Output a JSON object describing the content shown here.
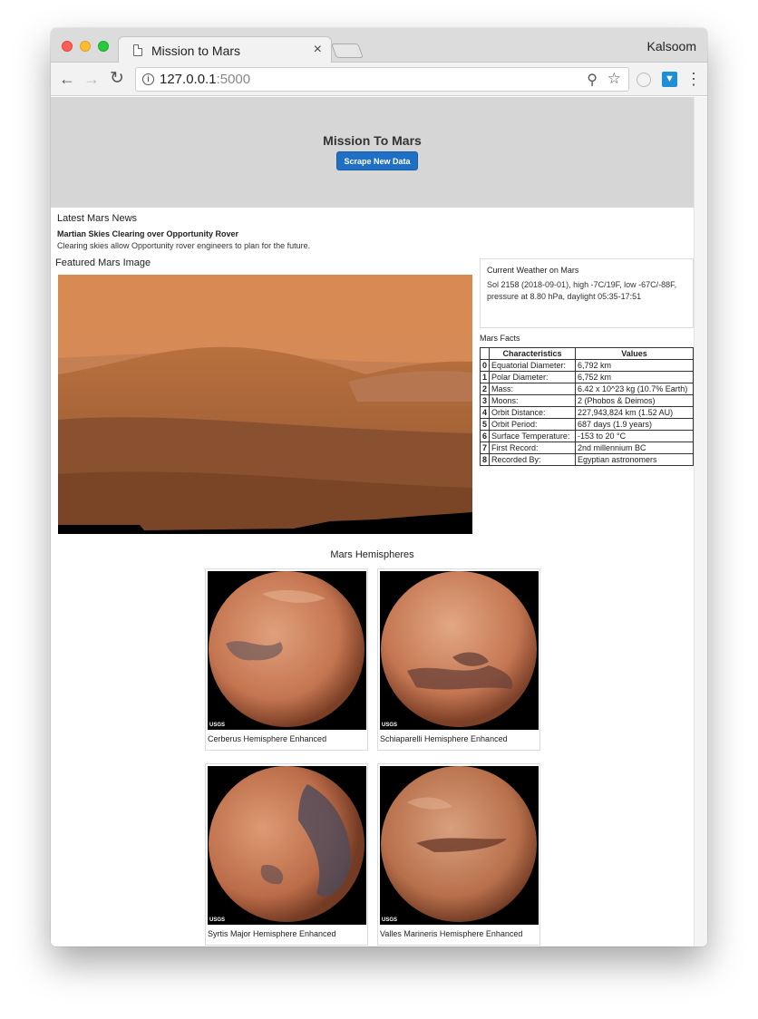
{
  "browser": {
    "tab_title": "Mission to Mars",
    "tab_close": "×",
    "profile_name": "Kalsoom",
    "url_host": "127.0.0.1",
    "url_port": ":5000"
  },
  "header": {
    "title": "Mission To Mars",
    "scrape_button": "Scrape New Data"
  },
  "news": {
    "heading": "Latest Mars News",
    "title": "Martian Skies Clearing over Opportunity Rover",
    "body": "Clearing skies allow Opportunity rover engineers to plan for the future."
  },
  "featured": {
    "heading": "Featured Mars Image"
  },
  "weather": {
    "heading": "Current Weather on Mars",
    "text": "Sol 2158 (2018-09-01), high -7C/19F, low -67C/-88F, pressure at 8.80 hPa, daylight 05:35-17:51"
  },
  "facts": {
    "heading": "Mars Facts",
    "columns": [
      "Characteristics",
      "Values"
    ],
    "rows": [
      {
        "idx": "0",
        "char": "Equatorial Diameter:",
        "value": "6,792 km"
      },
      {
        "idx": "1",
        "char": "Polar Diameter:",
        "value": "6,752 km"
      },
      {
        "idx": "2",
        "char": "Mass:",
        "value": "6.42 x 10^23 kg (10.7% Earth)"
      },
      {
        "idx": "3",
        "char": "Moons:",
        "value": "2 (Phobos & Deimos)"
      },
      {
        "idx": "4",
        "char": "Orbit Distance:",
        "value": "227,943,824 km (1.52 AU)"
      },
      {
        "idx": "5",
        "char": "Orbit Period:",
        "value": "687 days (1.9 years)"
      },
      {
        "idx": "6",
        "char": "Surface Temperature:",
        "value": "-153 to 20 °C"
      },
      {
        "idx": "7",
        "char": "First Record:",
        "value": "2nd millennium BC"
      },
      {
        "idx": "8",
        "char": "Recorded By:",
        "value": "Egyptian astronomers"
      }
    ]
  },
  "hemispheres": {
    "heading": "Mars Hemispheres",
    "items": [
      {
        "caption": "Cerberus Hemisphere Enhanced",
        "usgs": "USGS"
      },
      {
        "caption": "Schiaparelli Hemisphere Enhanced",
        "usgs": "USGS"
      },
      {
        "caption": "Syrtis Major Hemisphere Enhanced",
        "usgs": "USGS"
      },
      {
        "caption": "Valles Marineris Hemisphere Enhanced",
        "usgs": "USGS"
      }
    ]
  }
}
